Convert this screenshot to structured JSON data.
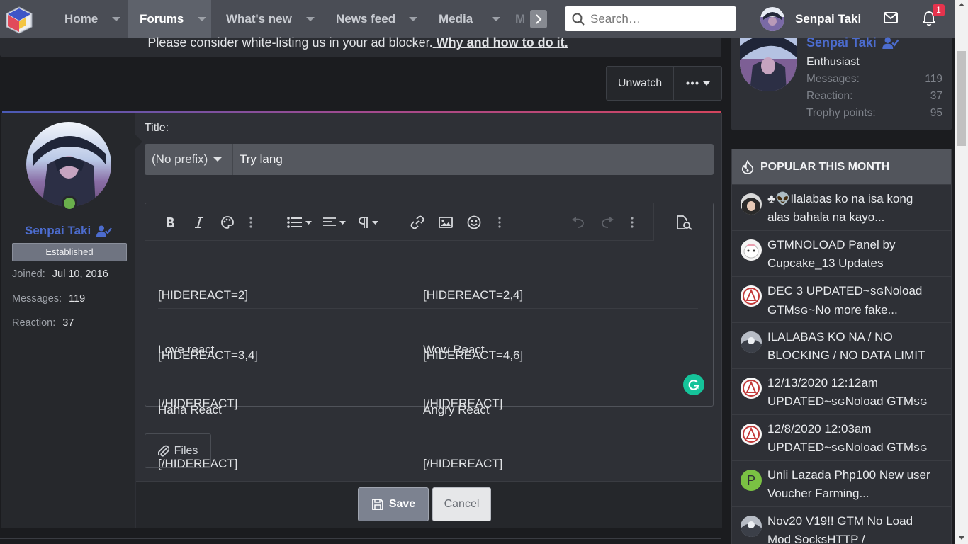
{
  "nav": {
    "tabs": [
      {
        "label": "Home"
      },
      {
        "label": "Forums"
      },
      {
        "label": "What's new"
      },
      {
        "label": "News feed"
      },
      {
        "label": "Media"
      },
      {
        "label": "M"
      }
    ],
    "search_placeholder": "Search…",
    "username": "Senpai Taki",
    "notification_count": "1"
  },
  "notice": {
    "text": "Please consider white-listing us in your ad blocker.",
    "link": "Why and how to do it."
  },
  "thread_actions": {
    "unwatch": "Unwatch"
  },
  "post_user": {
    "name": "Senpai Taki",
    "title": "Established",
    "joined_label": "Joined:",
    "joined": "Jul 10, 2016",
    "messages_label": "Messages:",
    "messages": "119",
    "reaction_label": "Reaction:",
    "reaction": "37"
  },
  "editor": {
    "title_label": "Title:",
    "prefix": "(No prefix)",
    "title_value": "Try lang",
    "blocks": [
      {
        "left": [
          "[HIDEREACT=2]",
          "Love react",
          "[/HIDEREACT]"
        ],
        "right": [
          "[HIDEREACT=2,4]",
          "Wow React",
          "[/HIDEREACT]"
        ]
      },
      {
        "left": [
          "[HIDEREACT=3,4]",
          "Haha React",
          "[/HIDEREACT]"
        ],
        "right": [
          "[HIDEREACT=4,6]",
          "Angry React",
          "[/HIDEREACT]"
        ]
      }
    ],
    "files_label": "Files",
    "save_label": "Save",
    "cancel_label": "Cancel"
  },
  "sidebar_user": {
    "name": "Senpai Taki",
    "title": "Enthusiast",
    "messages_label": "Messages:",
    "messages": "119",
    "reaction_label": "Reaction:",
    "reaction": "37",
    "trophy_label": "Trophy points:",
    "trophy": "95"
  },
  "popular": {
    "heading": "POPULAR THIS MONTH",
    "items": [
      {
        "line1": "♣👽Ilalabas ko na isa kong",
        "line2": "alas bahala na kayo...",
        "avatar": "dark"
      },
      {
        "line1": "GTMNOLOAD Panel by",
        "line2": "Cupcake_13 Updates",
        "avatar": "white"
      },
      {
        "line1": "DEC 3 UPDATED~",
        "sg1": "SG",
        "line1b": "Noload",
        "line2": "GTM",
        "sg2": "SG",
        "line2b": "~No more fake...",
        "avatar": "red"
      },
      {
        "line1": "ILALABAS KO NA / NO",
        "line2": "BLOCKING / NO DATA LIMIT",
        "avatar": "gray"
      },
      {
        "line1": "12/13/2020 12:12am",
        "line2": "UPDATED~",
        "sg2": "SG",
        "line2b": "Noload GTM",
        "sg3": "SG",
        "avatar": "red"
      },
      {
        "line1": "12/8/2020 12:03am",
        "line2": "UPDATED~",
        "sg2": "SG",
        "line2b": "Noload GTM",
        "sg3": "SG",
        "avatar": "red"
      },
      {
        "line1": "Unli Lazada Php100 New user",
        "line2": "Voucher Farming...",
        "avatar_letter": "P",
        "avatar": "green"
      },
      {
        "line1": "Nov20 V19!! GTM No Load",
        "line2": "Mod SocksHTTP /",
        "avatar": "gray"
      }
    ]
  },
  "colors": {
    "accent": "#4c6cce",
    "nav_bg": "#4a4d55",
    "page_bg": "#1b1c1f",
    "badge": "#e5334d",
    "online": "#6ab04c",
    "grammarly": "#15c39a"
  }
}
